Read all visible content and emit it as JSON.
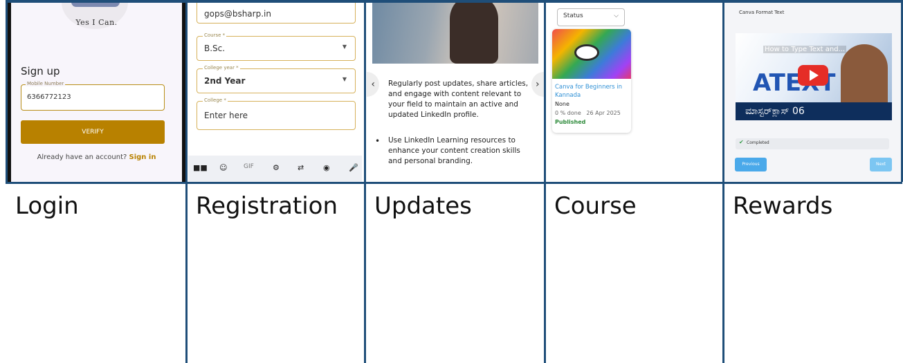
{
  "login": {
    "tagline": "Yes I Can.",
    "heading": "Sign up",
    "mobile_label": "Mobile Number",
    "mobile_value": "6366772123",
    "verify_label": "VERIFY",
    "already_text": "Already have an account?",
    "signin_link": "Sign in"
  },
  "registration": {
    "email_value": "gops@bsharp.in",
    "course_label": "Course *",
    "course_value": "B.Sc.",
    "year_label": "College year *",
    "year_value": "2nd Year",
    "college_label": "College *",
    "college_placeholder": "Enter here",
    "keyboard_gif": "GIF"
  },
  "updates": {
    "paragraph": "Regularly post updates, share articles, and engage with content relevant to your field to maintain an active and updated LinkedIn profile.",
    "bullet": "Use LinkedIn Learning resources to enhance your content creation skills and personal branding."
  },
  "course": {
    "status_label": "Status",
    "card_title": "Canva for Beginners in Kannada",
    "card_none": "None",
    "card_progress": "0 % done",
    "card_date": "26 Apr 2025",
    "card_status": "Published"
  },
  "rewards": {
    "format_text": "Canva Format Text",
    "video_title": "How to Type Text and...",
    "video_big_text": "ATEXT",
    "video_kannada": "ಮಾಸ್ಟರ್‌ಕ್ಲಾಸ್ 06",
    "completed_label": "Completed",
    "previous_label": "Previous",
    "next_label": "Next"
  },
  "captions": [
    "Login",
    "Registration",
    "Updates",
    "Course",
    "Rewards"
  ],
  "colors": {
    "border": "#1f4e79",
    "accent_gold": "#b88100",
    "link_blue": "#2d8fd5",
    "published_green": "#2d8a3a"
  }
}
